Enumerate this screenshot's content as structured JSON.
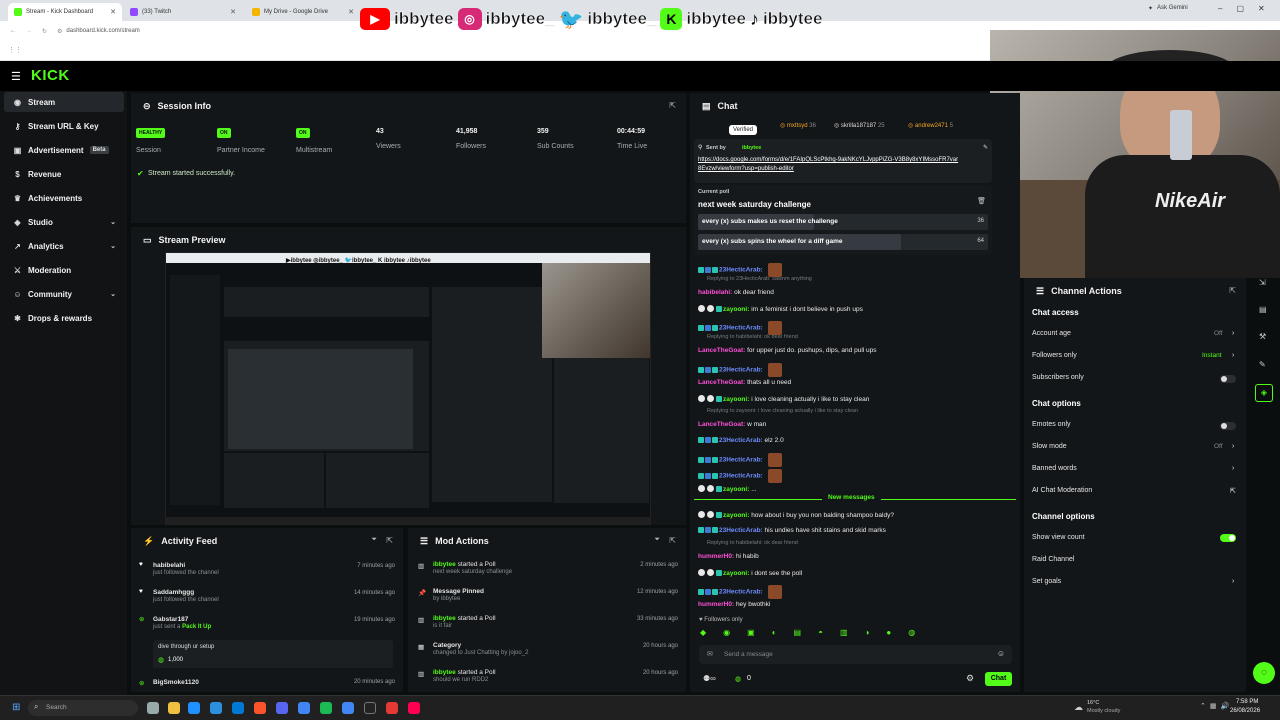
{
  "browser": {
    "tabs": [
      {
        "label": "Stream - Kick Dashboard"
      },
      {
        "label": "(33) Twitch"
      },
      {
        "label": "My Drive - Google Drive"
      }
    ],
    "url": "dashboard.kick.com/stream",
    "gemini": "Ask Gemini"
  },
  "overlay": {
    "handles": [
      "ibbytee",
      "ibbytee_",
      "ibbytee_",
      "ibbytee",
      "ibbytee"
    ]
  },
  "sidebar": {
    "items": [
      {
        "label": "Stream",
        "icon": "broadcast-icon"
      },
      {
        "label": "Stream URL & Key",
        "icon": "key-icon"
      },
      {
        "label": "Advertisement",
        "badge": "Beta",
        "icon": "megaphone-icon"
      },
      {
        "label": "Revenue",
        "icon": "dollar-icon"
      },
      {
        "label": "Achievements",
        "icon": "trophy-icon"
      },
      {
        "label": "Studio",
        "icon": "studio-icon"
      },
      {
        "label": "Analytics",
        "icon": "chart-icon"
      },
      {
        "label": "Moderation",
        "icon": "sword-icon"
      },
      {
        "label": "Community",
        "icon": "people-icon"
      },
      {
        "label": "Drops & rewards",
        "icon": "gift-icon"
      }
    ]
  },
  "session": {
    "title": "Session Info",
    "stats": [
      {
        "pill": "HEALTHY",
        "label": "Session"
      },
      {
        "pill": "ON",
        "label": "Partner Income"
      },
      {
        "pill": "ON",
        "label": "Multistream"
      },
      {
        "value": "43",
        "label": "Viewers"
      },
      {
        "value": "41,958",
        "label": "Followers"
      },
      {
        "value": "359",
        "label": "Sub Counts"
      },
      {
        "value": "00:44:59",
        "label": "Time Live"
      }
    ],
    "status": "Stream started successfully."
  },
  "preview": {
    "title": "Stream Preview"
  },
  "activity": {
    "title": "Activity Feed",
    "items": [
      {
        "user": "habibelahi",
        "text": "just followed the channel",
        "time": "7 minutes ago"
      },
      {
        "user": "Saddamhggg",
        "text": "just followed the channel",
        "time": "14 minutes ago"
      },
      {
        "user": "Gabstar187",
        "text": "just sent a",
        "gift": "Pack It Up",
        "time": "19 minutes ago",
        "note": "dive through ur setup",
        "amount": "1,000"
      },
      {
        "user": "BigSmoke1120",
        "time": "20 minutes ago"
      }
    ]
  },
  "mod": {
    "title": "Mod Actions",
    "items": [
      {
        "user": "ibbytee",
        "action": "started a Poll",
        "sub": "next week saturday challenge",
        "time": "2 minutes ago"
      },
      {
        "user": "Message Pinned",
        "sub": "by ibbytee",
        "time": "12 minutes ago"
      },
      {
        "user": "ibbytee",
        "action": "started a Poll",
        "sub": "is it fair",
        "time": "33 minutes ago"
      },
      {
        "user": "Category",
        "sub": "changed to Just Chatting by jojoo_2",
        "time": "20 hours ago"
      },
      {
        "user": "ibbytee",
        "action": "started a Poll",
        "sub": "should we run RDD2",
        "time": "20 hours ago"
      }
    ]
  },
  "chat": {
    "title": "Chat",
    "top_users": [
      {
        "name": "mxttsyd",
        "n": "36"
      },
      {
        "name": "skrilla187187",
        "n": "25"
      },
      {
        "name": "andrew2471",
        "n": "5"
      }
    ],
    "verified": "Verified",
    "pinned": {
      "sent_by": "Sent by",
      "user": "ibbytee",
      "link": "https://docs.google.com/forms/d/e/1FAIpQLScPtkhg-9akNKcYLJvppPiZG-V3B8y8xYIMssoFR7var8Evzw/viewform?usp=publish-editor"
    },
    "poll": {
      "label": "Current poll",
      "question": "next week saturday challenge",
      "options": [
        {
          "text": "every (x) subs makes us reset the challenge",
          "votes": "36",
          "pct": 0.4
        },
        {
          "text": "every (x) subs spins the wheel for a diff game",
          "votes": "64",
          "pct": 0.7
        }
      ]
    },
    "messages": [
      {
        "reply": "",
        "user": "23HecticArab:",
        "text": "",
        "color": "#6b8cff"
      },
      {
        "reply": "Replying to 23HecticArab: sawnm anything",
        "user": "habibelahi:",
        "text": "ok dear friend",
        "color": "#ff4fd8"
      },
      {
        "reply": "",
        "user": "zayooni:",
        "text": "im a feminist i dont believe in push ups",
        "color": "#53fc18"
      },
      {
        "reply": "",
        "user": "23HecticArab:",
        "text": "",
        "color": "#6b8cff"
      },
      {
        "reply": "Replying to habibelahi: ok dear friend",
        "user": "LanceTheGoat:",
        "text": "for upper just do. pushups, dips, and pull ups",
        "color": "#ff4fd8"
      },
      {
        "reply": "",
        "user": "23HecticArab:",
        "text": "",
        "color": "#6b8cff"
      },
      {
        "reply": "",
        "user": "LanceTheGoat:",
        "text": "thats all u need",
        "color": "#ff4fd8"
      },
      {
        "reply": "",
        "user": "zayooni:",
        "text": "i love cleaning actually i like to stay clean",
        "color": "#53fc18"
      },
      {
        "reply": "Replying to zayooni: i love cleaning actually i like to stay clean",
        "user": "LanceTheGoat:",
        "text": "w man",
        "color": "#ff4fd8"
      },
      {
        "reply": "",
        "user": "23HecticArab:",
        "text": "elz 2.0",
        "color": "#6b8cff"
      },
      {
        "reply": "",
        "user": "23HecticArab:",
        "text": "",
        "color": "#6b8cff"
      },
      {
        "reply": "",
        "user": "23HecticArab:",
        "text": "",
        "color": "#6b8cff"
      },
      {
        "reply": "",
        "user": "zayooni:",
        "text": "...",
        "color": "#53fc18"
      }
    ],
    "new_messages": "New messages",
    "messages2": [
      {
        "reply": "",
        "user": "zayooni:",
        "text": "how about i buy you non balding shampoo baldy?",
        "color": "#53fc18"
      },
      {
        "reply": "",
        "user": "23HecticArab:",
        "text": "his undies have shit stains and skid marks",
        "color": "#6b8cff"
      },
      {
        "reply": "Replying to habibelahi: ok dear friend",
        "user": "hummerH0:",
        "text": "hi habib",
        "color": "#ff4fd8"
      },
      {
        "reply": "",
        "user": "zayooni:",
        "text": "i dont see the poll",
        "color": "#53fc18"
      },
      {
        "reply": "",
        "user": "23HecticArab:",
        "text": "",
        "color": "#6b8cff"
      },
      {
        "reply": "",
        "user": "hummerH0:",
        "text": "hey bwothki",
        "color": "#ff4fd8"
      }
    ],
    "followers_only": "Followers only",
    "placeholder": "Send a message",
    "send": "Chat",
    "count": "0"
  },
  "channel_actions": {
    "title": "Channel Actions",
    "chat_access": "Chat access",
    "account_age": {
      "label": "Account age",
      "value": "Off"
    },
    "followers_only": {
      "label": "Followers only",
      "value": "Instant"
    },
    "subscribers_only": {
      "label": "Subscribers only"
    },
    "chat_options": "Chat options",
    "emotes_only": {
      "label": "Emotes only"
    },
    "slow_mode": {
      "label": "Slow mode",
      "value": "Off"
    },
    "banned_words": {
      "label": "Banned words"
    },
    "ai_mod": {
      "label": "AI Chat Moderation"
    },
    "channel_options": "Channel options",
    "show_view_count": {
      "label": "Show view count"
    },
    "raid": {
      "label": "Raid Channel"
    },
    "set_goals": {
      "label": "Set goals"
    }
  },
  "taskbar": {
    "search": "Search",
    "weather": "16°C",
    "weather2": "Mostly cloudy",
    "time": "7:58 PM",
    "date": "26/08/2026"
  },
  "colors": {
    "accent": "#53fc18",
    "bg": "#0b0e0f",
    "panel": "#131618"
  }
}
